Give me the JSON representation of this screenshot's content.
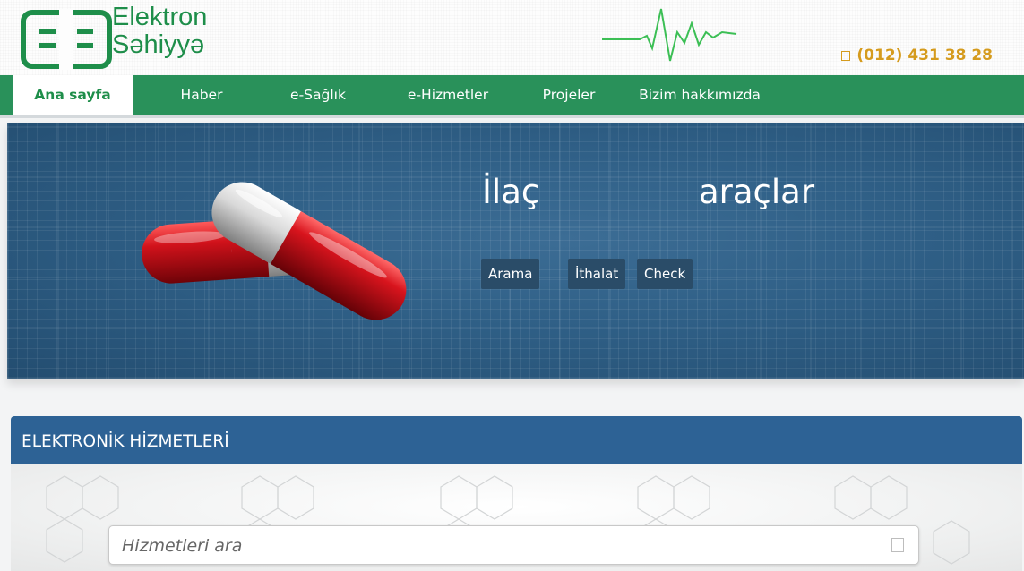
{
  "brand": {
    "line1": "Elektron",
    "line2": "Səhiyyə"
  },
  "contact": {
    "phone": "(012) 431 38 28",
    "icon": "phone-icon"
  },
  "nav": {
    "items": [
      {
        "label": "Ana sayfa",
        "active": true
      },
      {
        "label": "Haber"
      },
      {
        "label": "e-Sağlık"
      },
      {
        "label": "e-Hizmetler"
      },
      {
        "label": "Projeler"
      },
      {
        "label": "Bizim hakkımızda"
      }
    ]
  },
  "hero": {
    "title_left": "İlaç",
    "title_right": "araçlar",
    "buttons": [
      "Arama",
      "İthalat",
      "Check"
    ]
  },
  "services": {
    "heading": "ELEKTRONİK HİZMETLERİ",
    "search_placeholder": "Hizmetleri ara"
  },
  "colors": {
    "brand_green": "#29915a",
    "phone_gold": "#d59b1d",
    "hero_blue": "#2f5f86",
    "panel_blue": "#2d6295"
  }
}
